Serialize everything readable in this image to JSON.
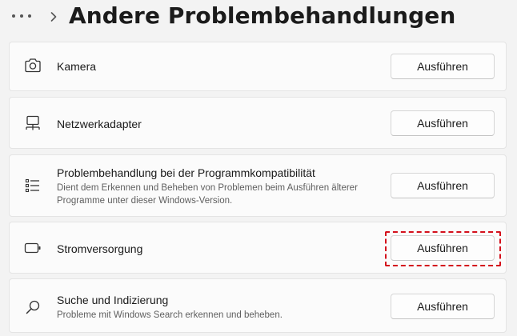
{
  "header": {
    "more_icon": "more-dots-icon",
    "chevron_icon": "chevron-right-icon",
    "title": "Andere Problembehandlungen"
  },
  "items": [
    {
      "icon": "camera-icon",
      "label": "Kamera",
      "description": "",
      "button": "Ausführen"
    },
    {
      "icon": "network-adapter-icon",
      "label": "Netzwerkadapter",
      "description": "",
      "button": "Ausführen"
    },
    {
      "icon": "list-icon",
      "label": "Problembehandlung bei der Programmkompatibilität",
      "description": "Dient dem Erkennen und Beheben von Problemen beim Ausführen älterer Programme unter dieser Windows-Version.",
      "button": "Ausführen"
    },
    {
      "icon": "battery-icon",
      "label": "Stromversorgung",
      "description": "",
      "button": "Ausführen"
    },
    {
      "icon": "search-icon",
      "label": "Suche und Indizierung",
      "description": "Probleme mit Windows Search erkennen und beheben.",
      "button": "Ausführen"
    }
  ],
  "colors": {
    "highlight": "#d4101c",
    "background": "#f3f3f3",
    "card": "#fbfbfb"
  }
}
